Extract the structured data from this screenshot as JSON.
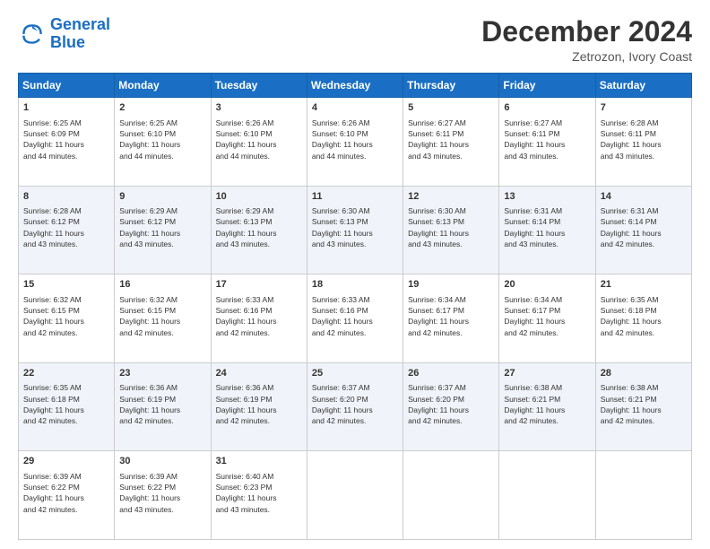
{
  "logo": {
    "line1": "General",
    "line2": "Blue"
  },
  "title": "December 2024",
  "subtitle": "Zetrozon, Ivory Coast",
  "days_header": [
    "Sunday",
    "Monday",
    "Tuesday",
    "Wednesday",
    "Thursday",
    "Friday",
    "Saturday"
  ],
  "weeks": [
    [
      {
        "day": "1",
        "info": "Sunrise: 6:25 AM\nSunset: 6:09 PM\nDaylight: 11 hours\nand 44 minutes."
      },
      {
        "day": "2",
        "info": "Sunrise: 6:25 AM\nSunset: 6:10 PM\nDaylight: 11 hours\nand 44 minutes."
      },
      {
        "day": "3",
        "info": "Sunrise: 6:26 AM\nSunset: 6:10 PM\nDaylight: 11 hours\nand 44 minutes."
      },
      {
        "day": "4",
        "info": "Sunrise: 6:26 AM\nSunset: 6:10 PM\nDaylight: 11 hours\nand 44 minutes."
      },
      {
        "day": "5",
        "info": "Sunrise: 6:27 AM\nSunset: 6:11 PM\nDaylight: 11 hours\nand 43 minutes."
      },
      {
        "day": "6",
        "info": "Sunrise: 6:27 AM\nSunset: 6:11 PM\nDaylight: 11 hours\nand 43 minutes."
      },
      {
        "day": "7",
        "info": "Sunrise: 6:28 AM\nSunset: 6:11 PM\nDaylight: 11 hours\nand 43 minutes."
      }
    ],
    [
      {
        "day": "8",
        "info": "Sunrise: 6:28 AM\nSunset: 6:12 PM\nDaylight: 11 hours\nand 43 minutes."
      },
      {
        "day": "9",
        "info": "Sunrise: 6:29 AM\nSunset: 6:12 PM\nDaylight: 11 hours\nand 43 minutes."
      },
      {
        "day": "10",
        "info": "Sunrise: 6:29 AM\nSunset: 6:13 PM\nDaylight: 11 hours\nand 43 minutes."
      },
      {
        "day": "11",
        "info": "Sunrise: 6:30 AM\nSunset: 6:13 PM\nDaylight: 11 hours\nand 43 minutes."
      },
      {
        "day": "12",
        "info": "Sunrise: 6:30 AM\nSunset: 6:13 PM\nDaylight: 11 hours\nand 43 minutes."
      },
      {
        "day": "13",
        "info": "Sunrise: 6:31 AM\nSunset: 6:14 PM\nDaylight: 11 hours\nand 43 minutes."
      },
      {
        "day": "14",
        "info": "Sunrise: 6:31 AM\nSunset: 6:14 PM\nDaylight: 11 hours\nand 42 minutes."
      }
    ],
    [
      {
        "day": "15",
        "info": "Sunrise: 6:32 AM\nSunset: 6:15 PM\nDaylight: 11 hours\nand 42 minutes."
      },
      {
        "day": "16",
        "info": "Sunrise: 6:32 AM\nSunset: 6:15 PM\nDaylight: 11 hours\nand 42 minutes."
      },
      {
        "day": "17",
        "info": "Sunrise: 6:33 AM\nSunset: 6:16 PM\nDaylight: 11 hours\nand 42 minutes."
      },
      {
        "day": "18",
        "info": "Sunrise: 6:33 AM\nSunset: 6:16 PM\nDaylight: 11 hours\nand 42 minutes."
      },
      {
        "day": "19",
        "info": "Sunrise: 6:34 AM\nSunset: 6:17 PM\nDaylight: 11 hours\nand 42 minutes."
      },
      {
        "day": "20",
        "info": "Sunrise: 6:34 AM\nSunset: 6:17 PM\nDaylight: 11 hours\nand 42 minutes."
      },
      {
        "day": "21",
        "info": "Sunrise: 6:35 AM\nSunset: 6:18 PM\nDaylight: 11 hours\nand 42 minutes."
      }
    ],
    [
      {
        "day": "22",
        "info": "Sunrise: 6:35 AM\nSunset: 6:18 PM\nDaylight: 11 hours\nand 42 minutes."
      },
      {
        "day": "23",
        "info": "Sunrise: 6:36 AM\nSunset: 6:19 PM\nDaylight: 11 hours\nand 42 minutes."
      },
      {
        "day": "24",
        "info": "Sunrise: 6:36 AM\nSunset: 6:19 PM\nDaylight: 11 hours\nand 42 minutes."
      },
      {
        "day": "25",
        "info": "Sunrise: 6:37 AM\nSunset: 6:20 PM\nDaylight: 11 hours\nand 42 minutes."
      },
      {
        "day": "26",
        "info": "Sunrise: 6:37 AM\nSunset: 6:20 PM\nDaylight: 11 hours\nand 42 minutes."
      },
      {
        "day": "27",
        "info": "Sunrise: 6:38 AM\nSunset: 6:21 PM\nDaylight: 11 hours\nand 42 minutes."
      },
      {
        "day": "28",
        "info": "Sunrise: 6:38 AM\nSunset: 6:21 PM\nDaylight: 11 hours\nand 42 minutes."
      }
    ],
    [
      {
        "day": "29",
        "info": "Sunrise: 6:39 AM\nSunset: 6:22 PM\nDaylight: 11 hours\nand 42 minutes."
      },
      {
        "day": "30",
        "info": "Sunrise: 6:39 AM\nSunset: 6:22 PM\nDaylight: 11 hours\nand 43 minutes."
      },
      {
        "day": "31",
        "info": "Sunrise: 6:40 AM\nSunset: 6:23 PM\nDaylight: 11 hours\nand 43 minutes."
      },
      null,
      null,
      null,
      null
    ]
  ]
}
